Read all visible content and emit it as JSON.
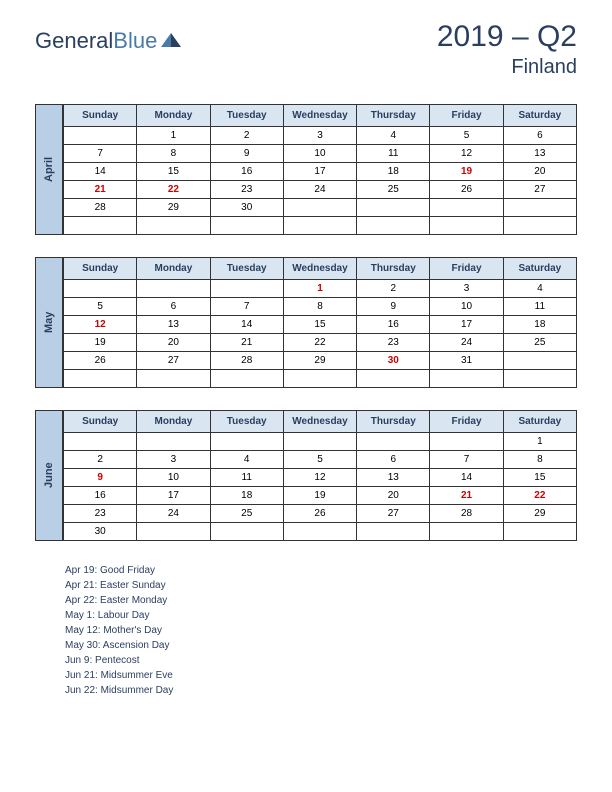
{
  "logo": {
    "general": "General",
    "blue": "Blue"
  },
  "title": {
    "main": "2019 – Q2",
    "country": "Finland"
  },
  "days": [
    "Sunday",
    "Monday",
    "Tuesday",
    "Wednesday",
    "Thursday",
    "Friday",
    "Saturday"
  ],
  "months": [
    {
      "name": "April",
      "weeks": [
        [
          null,
          {
            "d": 1
          },
          {
            "d": 2
          },
          {
            "d": 3
          },
          {
            "d": 4
          },
          {
            "d": 5
          },
          {
            "d": 6
          }
        ],
        [
          {
            "d": 7
          },
          {
            "d": 8
          },
          {
            "d": 9
          },
          {
            "d": 10
          },
          {
            "d": 11
          },
          {
            "d": 12
          },
          {
            "d": 13
          }
        ],
        [
          {
            "d": 14
          },
          {
            "d": 15
          },
          {
            "d": 16
          },
          {
            "d": 17
          },
          {
            "d": 18
          },
          {
            "d": 19,
            "h": true
          },
          {
            "d": 20
          }
        ],
        [
          {
            "d": 21,
            "h": true
          },
          {
            "d": 22,
            "h": true
          },
          {
            "d": 23
          },
          {
            "d": 24
          },
          {
            "d": 25
          },
          {
            "d": 26
          },
          {
            "d": 27
          }
        ],
        [
          {
            "d": 28
          },
          {
            "d": 29
          },
          {
            "d": 30
          },
          null,
          null,
          null,
          null
        ],
        [
          null,
          null,
          null,
          null,
          null,
          null,
          null
        ]
      ]
    },
    {
      "name": "May",
      "weeks": [
        [
          null,
          null,
          null,
          {
            "d": 1,
            "h": true
          },
          {
            "d": 2
          },
          {
            "d": 3
          },
          {
            "d": 4
          }
        ],
        [
          {
            "d": 5
          },
          {
            "d": 6
          },
          {
            "d": 7
          },
          {
            "d": 8
          },
          {
            "d": 9
          },
          {
            "d": 10
          },
          {
            "d": 11
          }
        ],
        [
          {
            "d": 12,
            "h": true
          },
          {
            "d": 13
          },
          {
            "d": 14
          },
          {
            "d": 15
          },
          {
            "d": 16
          },
          {
            "d": 17
          },
          {
            "d": 18
          }
        ],
        [
          {
            "d": 19
          },
          {
            "d": 20
          },
          {
            "d": 21
          },
          {
            "d": 22
          },
          {
            "d": 23
          },
          {
            "d": 24
          },
          {
            "d": 25
          }
        ],
        [
          {
            "d": 26
          },
          {
            "d": 27
          },
          {
            "d": 28
          },
          {
            "d": 29
          },
          {
            "d": 30,
            "h": true
          },
          {
            "d": 31
          },
          null
        ],
        [
          null,
          null,
          null,
          null,
          null,
          null,
          null
        ]
      ]
    },
    {
      "name": "June",
      "weeks": [
        [
          null,
          null,
          null,
          null,
          null,
          null,
          {
            "d": 1
          }
        ],
        [
          {
            "d": 2
          },
          {
            "d": 3
          },
          {
            "d": 4
          },
          {
            "d": 5
          },
          {
            "d": 6
          },
          {
            "d": 7
          },
          {
            "d": 8
          }
        ],
        [
          {
            "d": 9,
            "h": true
          },
          {
            "d": 10
          },
          {
            "d": 11
          },
          {
            "d": 12
          },
          {
            "d": 13
          },
          {
            "d": 14
          },
          {
            "d": 15
          }
        ],
        [
          {
            "d": 16
          },
          {
            "d": 17
          },
          {
            "d": 18
          },
          {
            "d": 19
          },
          {
            "d": 20
          },
          {
            "d": 21,
            "h": true
          },
          {
            "d": 22,
            "h": true
          }
        ],
        [
          {
            "d": 23
          },
          {
            "d": 24
          },
          {
            "d": 25
          },
          {
            "d": 26
          },
          {
            "d": 27
          },
          {
            "d": 28
          },
          {
            "d": 29
          }
        ],
        [
          {
            "d": 30
          },
          null,
          null,
          null,
          null,
          null,
          null
        ]
      ]
    }
  ],
  "holidays": [
    "Apr 19: Good Friday",
    "Apr 21: Easter Sunday",
    "Apr 22: Easter Monday",
    "May 1: Labour Day",
    "May 12: Mother's Day",
    "May 30: Ascension Day",
    "Jun 9: Pentecost",
    "Jun 21: Midsummer Eve",
    "Jun 22: Midsummer Day"
  ]
}
